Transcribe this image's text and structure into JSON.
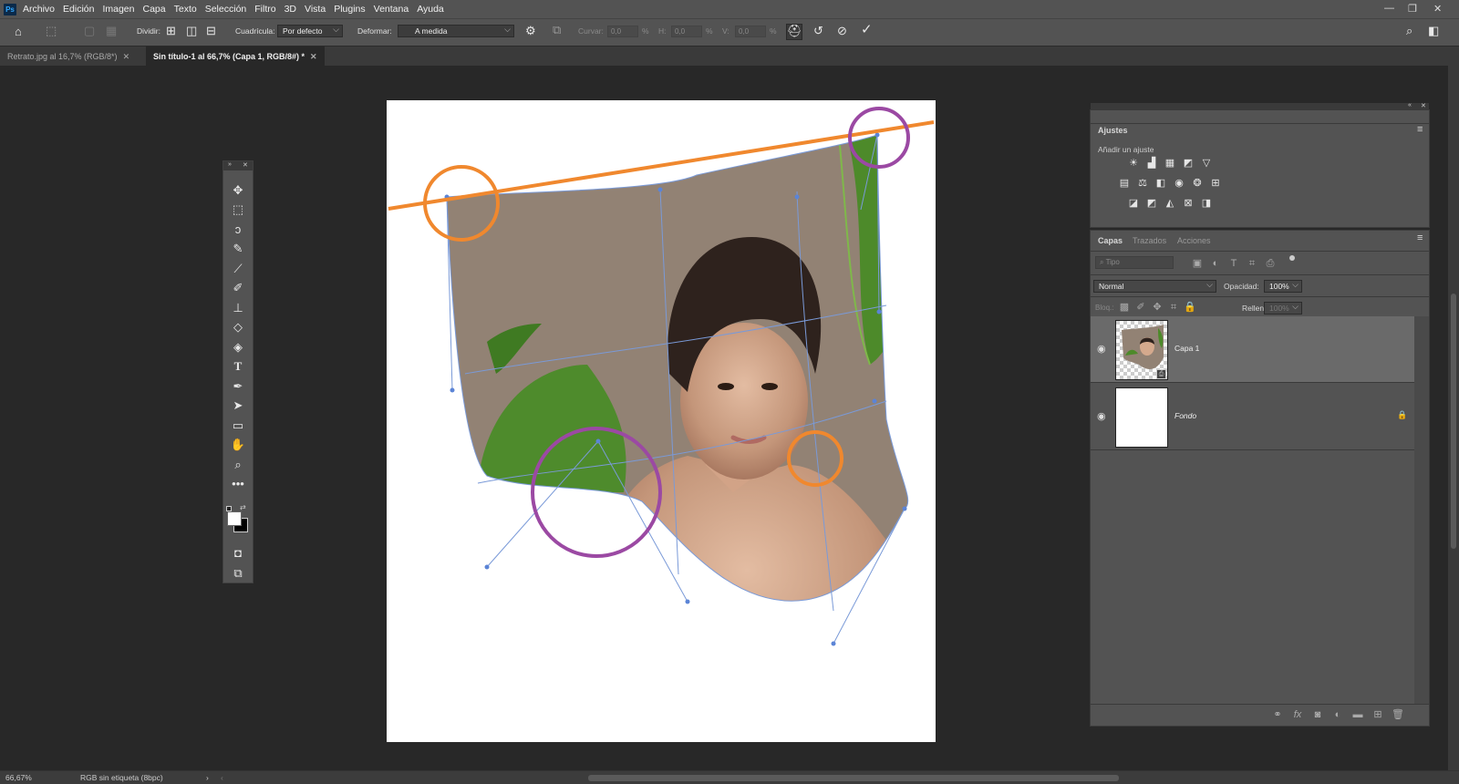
{
  "app": {
    "logo": "Ps"
  },
  "menubar": {
    "items": [
      "Archivo",
      "Edición",
      "Imagen",
      "Capa",
      "Texto",
      "Selección",
      "Filtro",
      "3D",
      "Vista",
      "Plugins",
      "Ventana",
      "Ayuda"
    ]
  },
  "options": {
    "split_label": "Dividir:",
    "grid_label": "Cuadrícula:",
    "grid_value": "Por defecto",
    "warp_label": "Deformar:",
    "warp_value": "A medida",
    "bend_label": "Curvar:",
    "bend_value": "0,0",
    "h_label": "H:",
    "h_value": "0,0",
    "v_label": "V:",
    "v_value": "0,0",
    "pct": "%"
  },
  "tabs": [
    {
      "label": "Retrato.jpg al 16,7% (RGB/8*)",
      "active": false
    },
    {
      "label": "Sin título-1 al 66,7% (Capa 1, RGB/8#) *",
      "active": true
    }
  ],
  "tools": [
    "move-tool",
    "marquee-tool",
    "lasso-tool",
    "quick-select-tool",
    "eyedropper-tool",
    "brush-tool",
    "stamp-tool",
    "eraser-tool",
    "gradient-tool",
    "type-tool",
    "pen-tool",
    "path-select-tool",
    "rectangle-tool",
    "hand-tool",
    "zoom-tool",
    "more-tools"
  ],
  "adjustments": {
    "tab": "Ajustes",
    "add_label": "Añadir un ajuste"
  },
  "layers_panel": {
    "tabs": [
      "Capas",
      "Trazados",
      "Acciones"
    ],
    "search_placeholder": "Tipo",
    "blend_mode": "Normal",
    "opacity_label": "Opacidad:",
    "opacity_value": "100%",
    "lock_label": "Bloq.:",
    "fill_label": "Relleno:",
    "fill_value": "100%",
    "layers": [
      {
        "name": "Capa 1",
        "selected": true,
        "visible": true
      },
      {
        "name": "Fondo",
        "selected": false,
        "visible": true,
        "locked": true
      }
    ]
  },
  "status": {
    "zoom": "66,67%",
    "profile": "RGB sin etiqueta (8bpc)"
  },
  "colors": {
    "accent_orange": "#f0882e",
    "accent_purple": "#9b49a3",
    "warp_lines": "#7a9ad8"
  }
}
